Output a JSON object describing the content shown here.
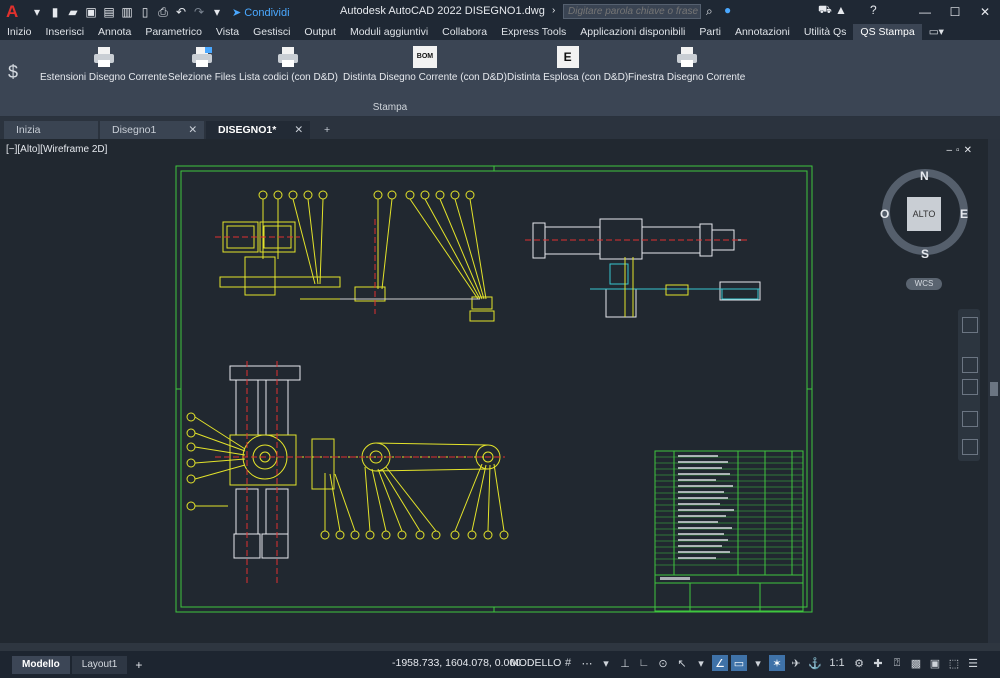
{
  "titlebar": {
    "app_logo": "A",
    "share_label": "Condividi",
    "title": "Autodesk AutoCAD 2022   DISEGNO1.dwg",
    "search_placeholder": "Digitare parola chiave o frase"
  },
  "menu": [
    "Inizio",
    "Inserisci",
    "Annota",
    "Parametrico",
    "Vista",
    "Gestisci",
    "Output",
    "Moduli aggiuntivi",
    "Collabora",
    "Express Tools",
    "Applicazioni disponibili",
    "Parti",
    "Annotazioni",
    "Utilità Qs",
    "QS Stampa"
  ],
  "ribbon": {
    "tools": [
      "Estensioni Disegno Corrente",
      "Selezione Files",
      "Lista codici (con D&D)",
      "Distinta Disegno Corrente (con D&D)",
      "Distinta Esplosa (con D&D)",
      "Finestra Disegno Corrente"
    ],
    "bom_badge": "BOM",
    "e_badge": "E",
    "panel_label": "Stampa"
  },
  "doc_tabs": [
    "Inizia",
    "Disegno1",
    "DISEGNO1*"
  ],
  "viewport": {
    "label": "[−][Alto][Wireframe 2D]",
    "viewcube": {
      "n": "N",
      "s": "S",
      "e": "E",
      "o": "O",
      "face": "ALTO",
      "ucs": "WCS"
    }
  },
  "layout_tabs": [
    "Modello",
    "Layout1"
  ],
  "status": {
    "coords": "-1958.733, 1604.078, 0.000",
    "mode": "MODELLO",
    "scale": "1:1"
  },
  "colors": {
    "drawing_yellow": "#e3e32a",
    "frame_green": "#3ec63e",
    "centerline_red": "#e03030",
    "cyan": "#36c6d0",
    "accent": "#3f72a8"
  },
  "icons": [
    "search-icon",
    "user-icon",
    "cart-icon",
    "help-icon",
    "gear-icon",
    "plus-icon"
  ]
}
